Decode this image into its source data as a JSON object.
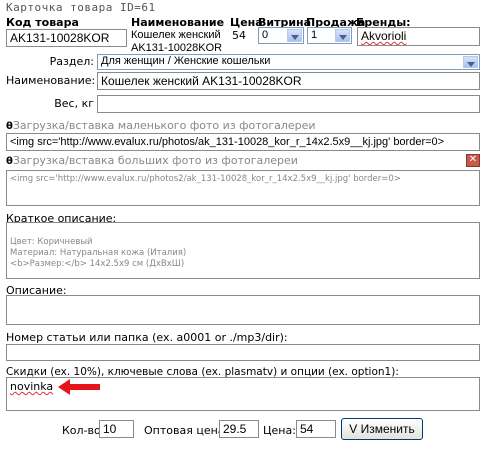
{
  "window": {
    "title": "Карточка товара ID=61"
  },
  "table": {
    "headers": [
      "Код товара",
      "Наименование",
      "Цена",
      "Витрина",
      "Продажа",
      "Бренды:"
    ],
    "code": "AK131-10028KOR",
    "name_line1": "Кошелек женский",
    "name_line2": "AK131-10028KOR",
    "price": "54",
    "vitrina": "0",
    "prodazha": "1",
    "brand": "Akvorioli"
  },
  "form": {
    "section_label": "Раздел:",
    "section_value": "Для женщин / Женские кошельки",
    "name_label": "Наименование:",
    "name_value": "Кошелек женский AK131-10028KOR",
    "weight_label": "Вес, кг",
    "weight_value": "",
    "small_photo_label": "Загрузка/вставка маленького фото из фотогалереи",
    "small_photo_value": "<img src='http://www.evalux.ru/photos/ak_131-10028_kor_r_14x2.5x9__kj.jpg' border=0>",
    "big_photo_label": "Загрузка/вставка больших фото из фотогалереи",
    "big_photo_value": "<img src='http://www.evalux.ru/photos2/ak_131-10028_kor_r_14x2.5x9__kj.jpg' border=0>",
    "short_desc_label": "Краткое описание:",
    "short_desc_lines": [
      "Цвет: Коричневый",
      "Материал: Натуральная кожа (Италия)",
      "<b>Размер:</b> 14x2.5x9 см (ДхВхШ)"
    ],
    "desc_label": "Описание:",
    "desc_value": "",
    "article_label": "Номер статьи или папка (ex. a0001 or ./mp3/dir):",
    "article_value": "",
    "keywords_label": "Скидки (ex. 10%), ключевые слова (ex. plasmatv) и опции (ex. option1):",
    "keywords_value": "novinka"
  },
  "footer": {
    "qty_label": "Кол-во:",
    "qty_value": "10",
    "wholesale_label": "Оптовая цена:",
    "wholesale_value": "29.5",
    "price_label": "Цена:",
    "price_value": "54",
    "submit_label": "V Изменить"
  },
  "colors": {
    "arrow": "#e8141b",
    "close_btn": "#c85a4a",
    "select_border": "#7f9db9"
  }
}
